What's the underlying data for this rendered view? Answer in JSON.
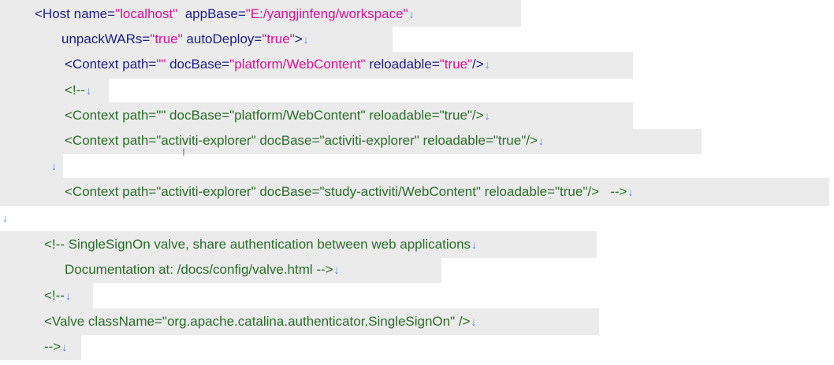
{
  "lines": [
    {
      "parts": [
        {
          "t": "<Host ",
          "c": "tag"
        },
        {
          "t": "name",
          "c": "attr"
        },
        {
          "t": "=",
          "c": "tag"
        },
        {
          "t": "\"localhost\"",
          "c": "val"
        },
        {
          "t": "  ",
          "c": "tag"
        },
        {
          "t": "appBase",
          "c": "attr"
        },
        {
          "t": "=",
          "c": "tag"
        },
        {
          "t": "\"E:/yangjinfeng/workspace\"",
          "c": "val"
        }
      ]
    },
    {
      "parts": [
        {
          "t": "unpackWARs",
          "c": "attr"
        },
        {
          "t": "=",
          "c": "tag"
        },
        {
          "t": "\"true\"",
          "c": "val"
        },
        {
          "t": " ",
          "c": "tag"
        },
        {
          "t": "autoDeploy",
          "c": "attr"
        },
        {
          "t": "=",
          "c": "tag"
        },
        {
          "t": "\"true\"",
          "c": "val"
        },
        {
          "t": ">",
          "c": "tag"
        }
      ]
    },
    {
      "parts": [
        {
          "t": "<Context ",
          "c": "tag"
        },
        {
          "t": "path",
          "c": "attr"
        },
        {
          "t": "=",
          "c": "tag"
        },
        {
          "t": "\"\"",
          "c": "val"
        },
        {
          "t": " ",
          "c": "tag"
        },
        {
          "t": "docBase",
          "c": "attr"
        },
        {
          "t": "=",
          "c": "tag"
        },
        {
          "t": "\"platform/WebContent\"",
          "c": "val"
        },
        {
          "t": " ",
          "c": "tag"
        },
        {
          "t": "reloadable",
          "c": "attr"
        },
        {
          "t": "=",
          "c": "tag"
        },
        {
          "t": "\"true\"",
          "c": "val"
        },
        {
          "t": "/>",
          "c": "tag"
        }
      ]
    },
    {
      "parts": [
        {
          "t": "<!--",
          "c": "tag"
        }
      ]
    },
    {
      "parts": [
        {
          "t": "<Context path=\"\" docBase=\"platform/WebContent\" reloadable=\"true\"/>",
          "c": "tag"
        }
      ]
    },
    {
      "parts": [
        {
          "t": "<Context path=\"activiti-explorer\" docBase=\"activiti-explorer\" reloadable=\"true\"/>",
          "c": "tag"
        }
      ]
    },
    {
      "parts": []
    },
    {
      "parts": [
        {
          "t": "<Context path=\"activiti-explorer\" docBase=\"study-activiti/WebContent\" reloadable=\"true\"/>   -->",
          "c": "tag"
        }
      ]
    },
    {
      "parts": []
    },
    {
      "parts": [
        {
          "t": "<!-- SingleSignOn valve, share authentication between web applications",
          "c": "tag"
        }
      ]
    },
    {
      "parts": [
        {
          "t": "Documentation at: /docs/config/valve.html -->",
          "c": "tag"
        }
      ]
    },
    {
      "parts": [
        {
          "t": "<!--",
          "c": "tag"
        }
      ]
    },
    {
      "parts": [
        {
          "t": "<Valve className=\"org.apache.catalina.authenticator.SingleSignOn\" />",
          "c": "tag"
        }
      ]
    },
    {
      "parts": [
        {
          "t": "-->",
          "c": "tag"
        }
      ]
    }
  ],
  "colors": {
    "tag": "#1d1d88",
    "value": "#d6119a",
    "comment": "#2c6c2c",
    "paragraph_mark": "#5b7fe6",
    "highlight": "#eaebea"
  },
  "icons": {
    "paragraph_mark": "paragraph-mark-icon",
    "text_cursor": "text-cursor-icon"
  }
}
